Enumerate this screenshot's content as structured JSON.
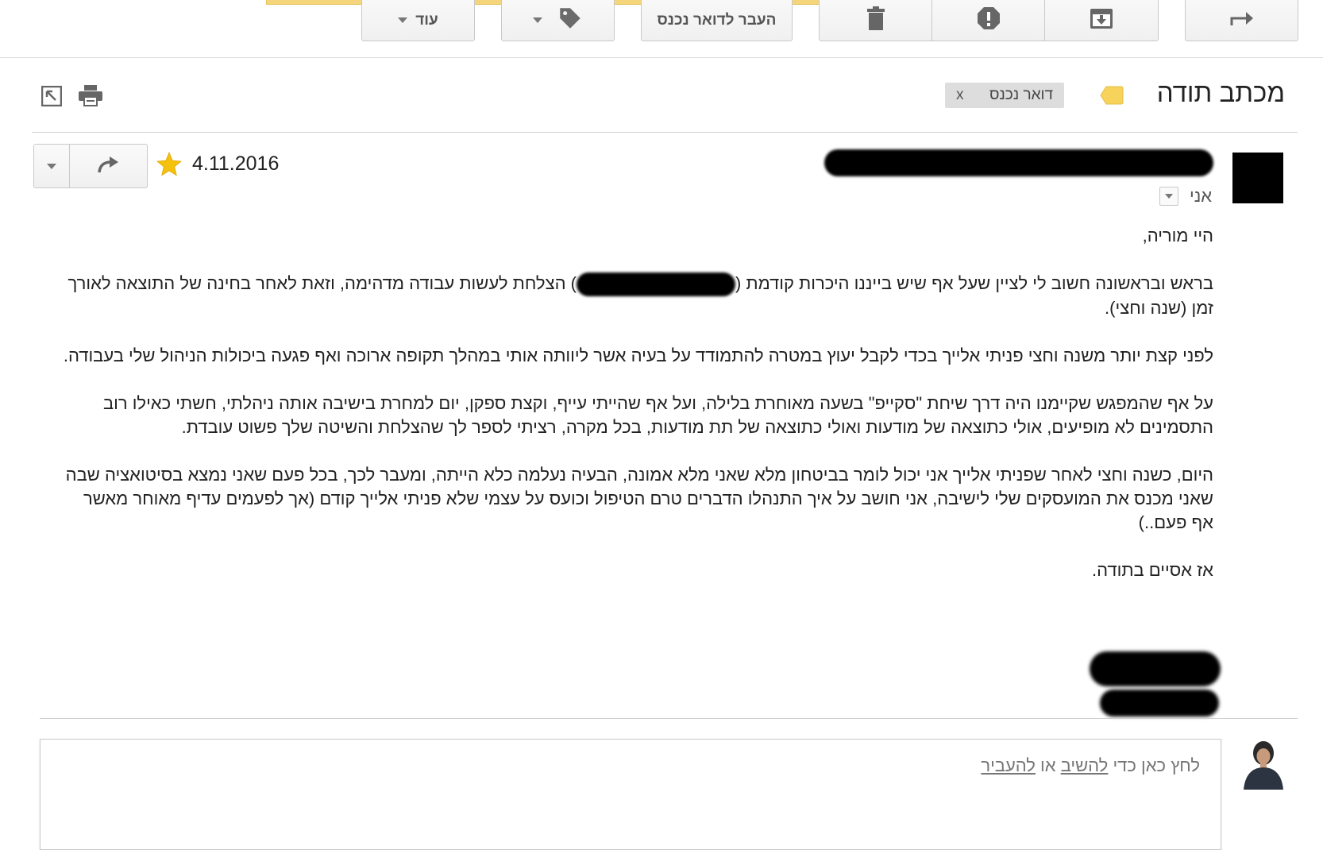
{
  "toolbar": {
    "more_label": "עוד",
    "move_to_inbox_label": "העבר לדואר נכנס"
  },
  "message": {
    "subject": "מכתב תודה",
    "label_chip": "דואר נכנס",
    "label_chip_remove": "x",
    "label_color": "#f7d35c",
    "recipient": "אני",
    "date": "4.11.2016",
    "star_color": "#f4c20d",
    "body": {
      "greeting": "היי מוריה,",
      "p1_before": "בראש ובראשונה חשוב לי לציין שעל אף שיש בייננו היכרות קודמת (",
      "p1_after": ") הצלחת לעשות עבודה מדהימה, וזאת לאחר בחינה של התוצאה לאורך זמן (שנה וחצי).",
      "p2": "לפני קצת יותר משנה וחצי פניתי אלייך בכדי לקבל יעוץ במטרה להתמודד על בעיה אשר ליוותה אותי במהלך תקופה ארוכה ואף פגעה ביכולות הניהול שלי בעבודה.",
      "p3": "על אף שהמפגש שקיימנו היה דרך שיחת \"סקייפ\" בשעה מאוחרת בלילה, ועל אף שהייתי עייף, וקצת ספקן, יום למחרת בישיבה אותה ניהלתי, חשתי כאילו רוב התסמינים לא מופיעים, אולי כתוצאה של מודעות ואולי כתוצאה של תת מודעות, בכל מקרה, רציתי לספר לך שהצלחת והשיטה שלך פשוט עובדת.",
      "p4": "היום, כשנה וחצי לאחר שפניתי אלייך אני יכול לומר בביטחון מלא שאני מלא אמונה, הבעיה נעלמה כלא הייתה, ומעבר לכך, בכל פעם שאני נמצא בסיטואציה שבה שאני מכנס את המועסקים שלי לישיבה, אני חושב על איך התנהלו הדברים טרם הטיפול וכועס על עצמי שלא פניתי אלייך קודם (אך לפעמים עדיף מאוחר מאשר אף פעם..)",
      "closing": "אז אסיים בתודה."
    }
  },
  "reply": {
    "prompt_prefix": "לחץ כאן כדי ",
    "reply_link": "להשיב",
    "or_text": " או ",
    "forward_link": "להעביר"
  }
}
